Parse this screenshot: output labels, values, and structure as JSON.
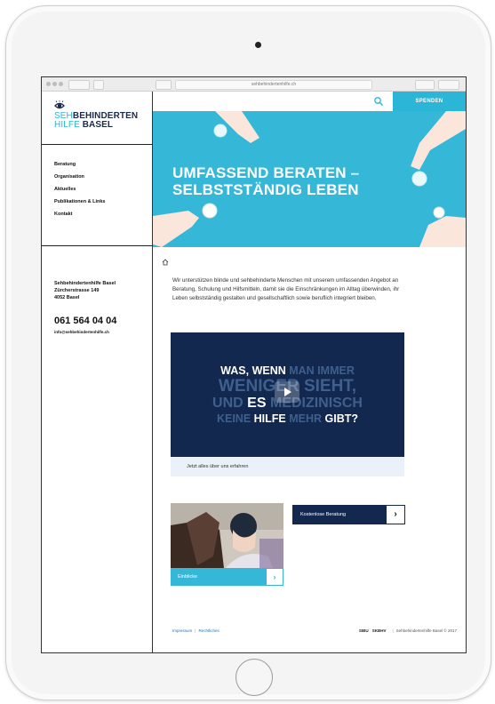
{
  "browser": {
    "url": "sehbehindertenhilfe.ch"
  },
  "sidebar": {
    "logo": {
      "line1_teal": "SEH",
      "line1_dark": "BEHINDERTEN",
      "line2_teal": "HILFE",
      "line2_dark": " BASEL"
    },
    "nav": [
      {
        "label": "Beratung"
      },
      {
        "label": "Organisation"
      },
      {
        "label": "Aktuelles"
      },
      {
        "label": "Publikationen & Links"
      },
      {
        "label": "Kontakt"
      }
    ],
    "address": {
      "name": "Sehbehindertenhilfe Basel",
      "street": "Zürcherstrasse 149",
      "city": "4052 Basel"
    },
    "phone": "061 564 04 04",
    "email": "info@sehbehindertenhilfe.ch"
  },
  "header": {
    "search_icon": "search-icon",
    "donate_label": "SPENDEN"
  },
  "hero": {
    "line1": "UMFASSEND BERATEN –",
    "line2": "SELBSTSTÄNDIG LEBEN"
  },
  "intro": "Wir unterstützen blinde und sehbehinderte Menschen mit unserem umfassenden Angebot an Beratung, Schulung und Hilfsmitteln, damit sie die Einschränkungen im Alltag überwinden, ihr Leben selbstständig gestalten und gesellschaftlich sowie beruflich integriert bleiben.",
  "video": {
    "l1a": "WAS, WENN",
    "l1b": " MAN IMMER",
    "l2": "WENIGER SIEHT,",
    "l3a": "UND ",
    "l3b": "ES",
    "l3c": " MEDIZINISCH",
    "l4a": "KEINE ",
    "l4b": "HILFE",
    "l4c": " MEHR ",
    "l4d": "GIBT?",
    "caption": "Jetzt alles über uns erfahren"
  },
  "cards": {
    "photo_label": "Einblicke",
    "cta_label": "Kostenlose Beratung"
  },
  "footer": {
    "impressum": "Impressum",
    "separator": "|",
    "rechtliches": "Rechtliches",
    "partner1": "SIBU",
    "partner2": "SKBHV",
    "copyright": "Sehbehindertenhilfe Basel © 2017"
  },
  "colors": {
    "accent_teal": "#2bb5d6",
    "navy": "#12284f"
  }
}
